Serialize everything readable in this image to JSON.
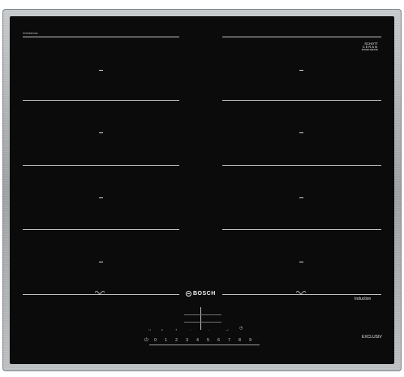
{
  "brand": "BOSCH",
  "top_right_logo": [
    "SCHOTT",
    "CERAN",
    "EXCELLENCE"
  ],
  "top_left_label": "PXX645FC1E",
  "induction_label": "Induction",
  "series_label": "EXCLUSIV",
  "control_labels": {
    "lock": "",
    "timer_icon": "◷",
    "plus_minus_left": "–",
    "plus_minus_right": "–",
    "wave_left": "〰",
    "wave_right": "〰"
  },
  "power_levels": [
    "0",
    "1",
    "2",
    "3",
    "4",
    "5",
    "6",
    "7",
    "8",
    "9"
  ],
  "power_button_label": "⏻"
}
